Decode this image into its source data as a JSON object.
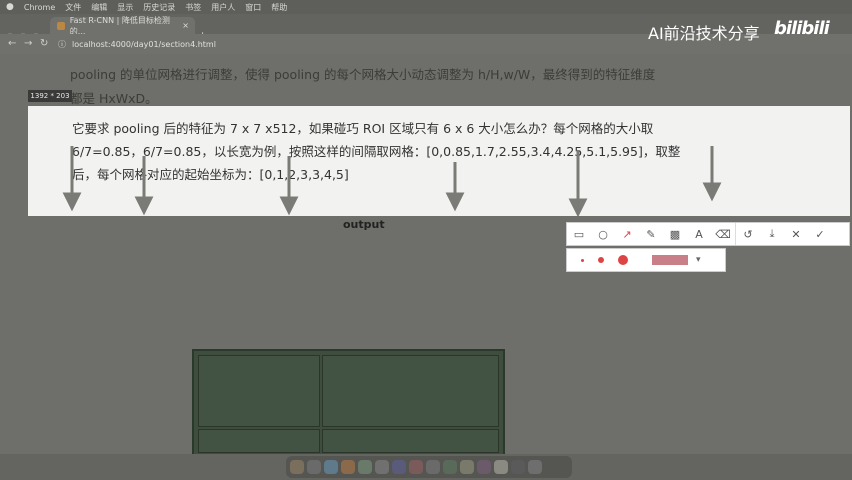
{
  "menubar": {
    "app": "Chrome",
    "items": [
      "文件",
      "编辑",
      "显示",
      "历史记录",
      "书签",
      "用户人",
      "窗口",
      "帮助"
    ]
  },
  "tab": {
    "title": "Fast R-CNN | 降低目标检测的..."
  },
  "address": {
    "url": "localhost:4000/day01/section4.html"
  },
  "content": {
    "line1": "pooling 的单位网格进行调整，使得 pooling 的每个网格大小动态调整为 h/H,w/W，最终得到的特征维度",
    "line2": "都是 HxWxD。"
  },
  "selection": {
    "size_badge": "1392 * 203",
    "line1": "它要求 pooling 后的特征为 7 x 7 x512，如果碰巧 ROI 区域只有 6 x 6 大小怎么办？每个网格的大小取",
    "line2": "6/7=0.85，6/7=0.85，以长宽为例，按照这样的间隔取网格：[0,0.85,1.7,2.55,3.4,4.25,5.1,5.95]，取整",
    "line3": "后，每个网格对应的起始坐标为：[0,1,2,3,3,4,5]"
  },
  "output_label": "output",
  "watermark": {
    "text": "AI前沿技术分享",
    "logo": "bilibili"
  },
  "annotation_toolbar": {
    "tools": [
      "rectangle-icon",
      "ellipse-icon",
      "arrow-icon",
      "pen-icon",
      "mosaic-icon",
      "text-icon",
      "eraser-icon",
      "undo-icon",
      "download-icon",
      "cancel-icon",
      "confirm-icon"
    ],
    "color": "#c87f87"
  }
}
